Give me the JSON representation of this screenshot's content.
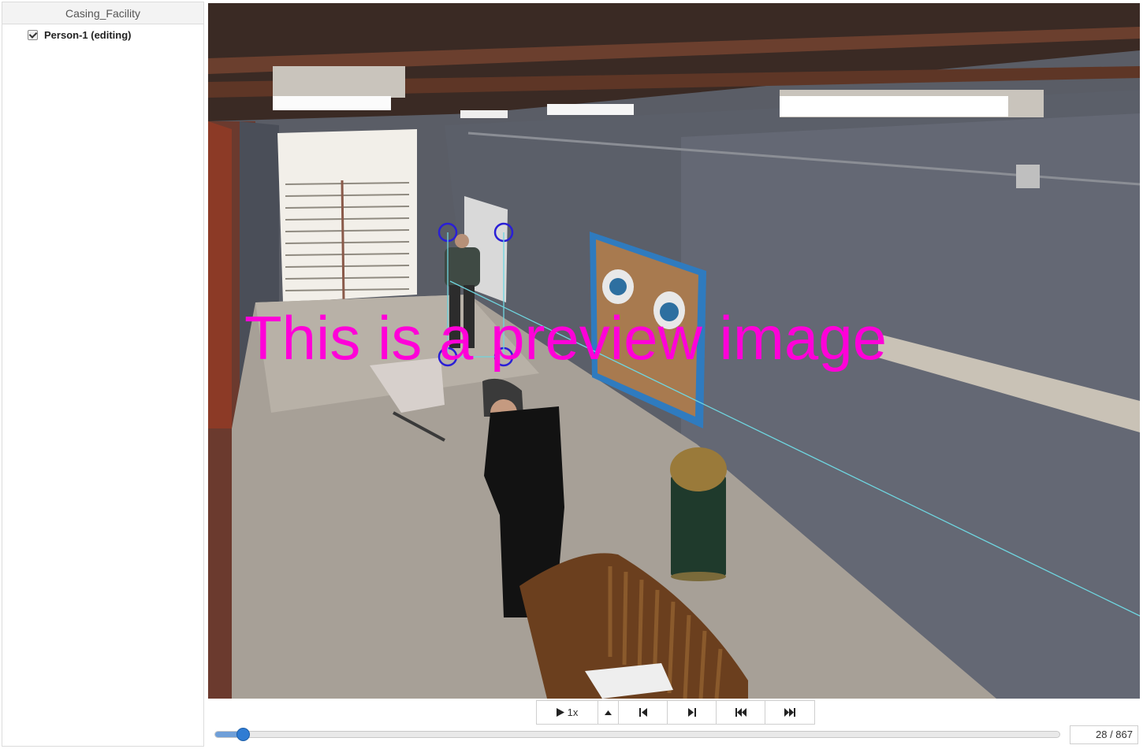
{
  "sidebar": {
    "title": "Casing_Facility",
    "tracks": [
      {
        "label": "Person-1 (editing)",
        "checked": true
      }
    ]
  },
  "viewer": {
    "watermark": "This is a preview image",
    "annotation_color": "#2a1fd6",
    "tracking_line_color": "#6fd6e0"
  },
  "controls": {
    "speed_label": "1x",
    "buttons": [
      "play-icon",
      "speed-up-icon",
      "step-back-icon",
      "step-forward-icon",
      "skip-to-start-icon",
      "skip-to-end-icon"
    ]
  },
  "timeline": {
    "progress": 0.0323,
    "accent": "#2f7cd3"
  },
  "frame_counter": {
    "text": "28 / 867",
    "current": 28,
    "total": 867
  }
}
